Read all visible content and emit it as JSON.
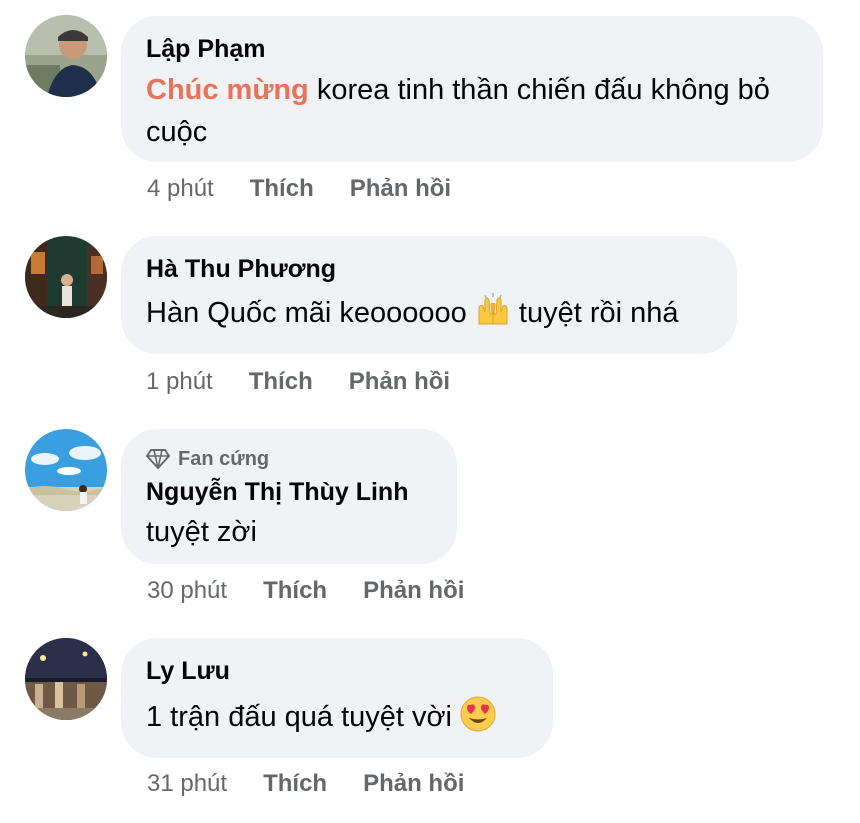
{
  "comments": [
    {
      "author": "Lập Phạm",
      "highlight": "Chúc mừng",
      "text": " korea tinh thần chiến đấu không bỏ cuộc",
      "time": "4 phút",
      "like_label": "Thích",
      "reply_label": "Phản hồi"
    },
    {
      "author": "Hà Thu Phương",
      "text_before": "Hàn Quốc mãi keoooooo ",
      "emoji": "raising-hands-icon",
      "text_after": " tuyệt rồi nhá",
      "time": "1 phút",
      "like_label": "Thích",
      "reply_label": "Phản hồi"
    },
    {
      "badge": "Fan cứng",
      "badge_icon": "diamond-icon",
      "author": "Nguyễn Thị Thùy Linh",
      "text": "tuyệt zời",
      "time": "30 phút",
      "like_label": "Thích",
      "reply_label": "Phản hồi"
    },
    {
      "author": "Ly Lưu",
      "text_before": "1 trận đấu quá tuyệt vời ",
      "emoji": "heart-eyes-icon",
      "time": "31 phút",
      "like_label": "Thích",
      "reply_label": "Phản hồi"
    }
  ],
  "colors": {
    "bubble_bg": "#f0f2f5",
    "secondary_text": "#65676b",
    "highlight": "#e8735a"
  }
}
